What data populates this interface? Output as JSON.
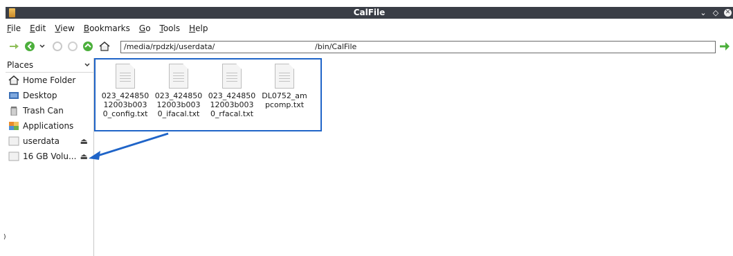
{
  "window": {
    "title": "CalFile"
  },
  "menu": [
    "File",
    "Edit",
    "View",
    "Bookmarks",
    "Go",
    "Tools",
    "Help"
  ],
  "toolbar": {
    "path_part1": "/media/rpdzkj/userdata/",
    "path_part2": "/bin/CalFile"
  },
  "sidebar": {
    "header": "Places",
    "items": [
      {
        "label": "Home Folder",
        "icon": "home-icon"
      },
      {
        "label": "Desktop",
        "icon": "desktop-icon"
      },
      {
        "label": "Trash Can",
        "icon": "trash-icon"
      },
      {
        "label": "Applications",
        "icon": "applications-icon"
      },
      {
        "label": "userdata",
        "icon": "drive-icon",
        "eject": "⏏"
      },
      {
        "label": "16 GB Volu...",
        "icon": "drive-icon",
        "eject": "⏏"
      }
    ]
  },
  "files": [
    {
      "line1": "023_424850",
      "line2": "12003b003",
      "line3": "0_config.txt"
    },
    {
      "line1": "023_424850",
      "line2": "12003b003",
      "line3": "0_ifacal.txt"
    },
    {
      "line1": "023_424850",
      "line2": "12003b003",
      "line3": "0_rfacal.txt"
    },
    {
      "line1": "DL0752_am",
      "line2": "pcomp.txt",
      "line3": ""
    }
  ],
  "colors": {
    "titlebar": "#3a3e46",
    "annotation": "#1f64c8"
  },
  "stray_mark": ")"
}
